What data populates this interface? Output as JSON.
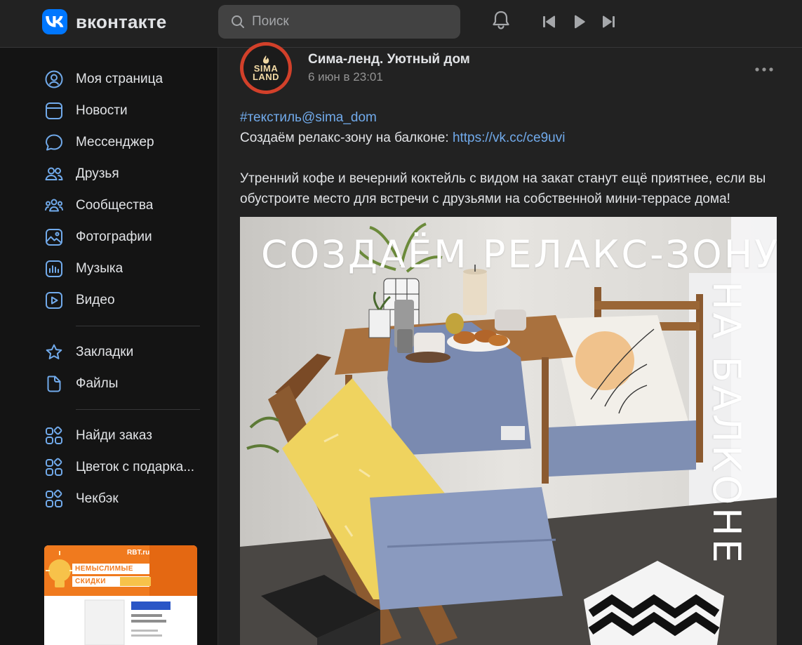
{
  "header": {
    "logo_text": "вконтакте",
    "search_placeholder": "Поиск",
    "icons": [
      "bell-icon",
      "previous-track-icon",
      "play-icon",
      "next-track-icon"
    ]
  },
  "sidebar": {
    "items": [
      {
        "label": "Моя страница",
        "icon": "profile-icon"
      },
      {
        "label": "Новости",
        "icon": "news-icon"
      },
      {
        "label": "Мессенджер",
        "icon": "messenger-icon"
      },
      {
        "label": "Друзья",
        "icon": "friends-icon"
      },
      {
        "label": "Сообщества",
        "icon": "communities-icon"
      },
      {
        "label": "Фотографии",
        "icon": "photos-icon"
      },
      {
        "label": "Музыка",
        "icon": "music-icon"
      },
      {
        "label": "Видео",
        "icon": "video-icon"
      }
    ],
    "items2": [
      {
        "label": "Закладки",
        "icon": "bookmark-star-icon"
      },
      {
        "label": "Файлы",
        "icon": "file-icon"
      }
    ],
    "apps": [
      {
        "label": "Найди заказ",
        "icon": "apps-icon"
      },
      {
        "label": "Цветок с подарка...",
        "icon": "apps-icon"
      },
      {
        "label": "Чекбэк",
        "icon": "apps-icon"
      }
    ],
    "ad": {
      "brand": "RBT.ru",
      "headline_1": "НЕМЫСЛИМЫЕ",
      "headline_2": "СКИДКИ"
    }
  },
  "post": {
    "avatar_line_1": "SIMA",
    "avatar_line_2": "LAND",
    "author": "Сима-ленд. Уютный дом",
    "date": "6 июн в 23:01",
    "hashtag": "#текстиль@sima_dom",
    "line2_text": "Создаём релакс-зону на балконе: ",
    "link": "https://vk.cc/ce9uvi",
    "paragraph": "Утренний кофе и вечерний коктейль с видом на закат станут ещё приятнее, если вы обустроите место для встречи с друзьями на собственной мини-террасе дома!",
    "photo": {
      "title_1": "СОЗДАЁМ РЕЛАКС-ЗОНУ",
      "title_2": "НА БАЛКОНЕ"
    }
  },
  "colors": {
    "accent": "#0077ff",
    "link": "#71aaeb",
    "icon": "#71aaeb",
    "background": "#141414",
    "card": "#222222"
  }
}
